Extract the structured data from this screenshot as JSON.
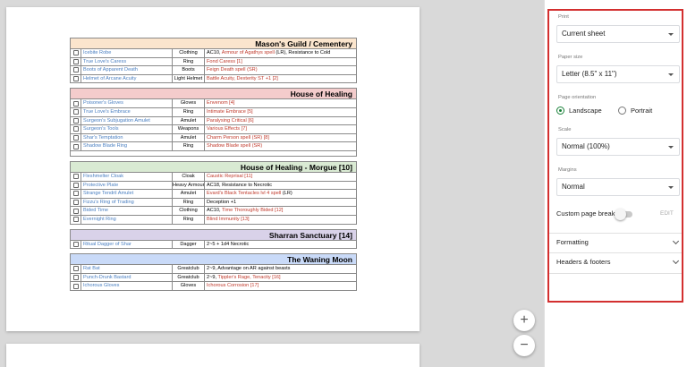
{
  "sheet": {
    "sections": [
      {
        "title": "Mason's Guild / Cementery",
        "color": "#fbe5cd",
        "rows": [
          {
            "name": "Icebite Robe",
            "type": "Clothing",
            "desc": [
              {
                "t": "AC10, ",
                "c": "black"
              },
              {
                "t": "Armour of Agathys spell",
                "c": "red"
              },
              {
                "t": " (LR), Resistance to Cold",
                "c": "black"
              }
            ]
          },
          {
            "name": "True Love's Caress",
            "type": "Ring",
            "desc": [
              {
                "t": "Fond Caress [1]",
                "c": "red"
              }
            ]
          },
          {
            "name": "Boots of Apparent Death",
            "type": "Boots",
            "desc": [
              {
                "t": "Feign Death spell (SR)",
                "c": "red"
              }
            ]
          },
          {
            "name": "Helmet of Arcane Acuity",
            "type": "Light Helmet",
            "desc": [
              {
                "t": "Battle Acuity, Dexterity ST +1 [2]",
                "c": "red"
              }
            ]
          }
        ]
      },
      {
        "title": "House of Healing",
        "color": "#f4cccc",
        "rows": [
          {
            "name": "Poisoner's Gloves",
            "type": "Gloves",
            "desc": [
              {
                "t": "Envenom [4]",
                "c": "red"
              }
            ]
          },
          {
            "name": "True Love's Embrace",
            "type": "Ring",
            "desc": [
              {
                "t": "Intimate Embrace [5]",
                "c": "red"
              }
            ]
          },
          {
            "name": "Surgeon's Subjugation Amulet",
            "type": "Amulet",
            "desc": [
              {
                "t": "Paralysing Critical [6]",
                "c": "red"
              }
            ]
          },
          {
            "name": "Surgeon's Tools",
            "type": "Weapons",
            "desc": [
              {
                "t": "Various Effects [7]",
                "c": "red"
              }
            ]
          },
          {
            "name": "Shar's Temptation",
            "type": "Amulet",
            "desc": [
              {
                "t": "Charm Person spell (SR) [8]",
                "c": "red"
              }
            ]
          },
          {
            "name": "Shadow Blade Ring",
            "type": "Ring",
            "desc": [
              {
                "t": "Shadow Blade spell (SR)",
                "c": "red"
              }
            ]
          }
        ],
        "spacer": true
      },
      {
        "title": "House of Healing - Morgue [10]",
        "color": "#d9ead3",
        "rows": [
          {
            "name": "Fleshmelter Cloak",
            "type": "Cloak",
            "desc": [
              {
                "t": "Caustic Reprisal [11]",
                "c": "red"
              }
            ]
          },
          {
            "name": "Protective Plate",
            "type": "Heavy Armour",
            "desc": [
              {
                "t": "AC18, Resistance to Necrotic",
                "c": "black"
              }
            ]
          },
          {
            "name": "Strange Tendril Amulet",
            "type": "Amulet",
            "desc": [
              {
                "t": "Evard's Black Tentacles lvl 4 spell",
                "c": "red"
              },
              {
                "t": " (LR)",
                "c": "black"
              }
            ]
          },
          {
            "name": "Fizzu's Ring of Trading",
            "type": "Ring",
            "desc": [
              {
                "t": "Deception +1",
                "c": "black"
              }
            ]
          },
          {
            "name": "Bided Time",
            "type": "Clothing",
            "desc": [
              {
                "t": "AC10, ",
                "c": "black"
              },
              {
                "t": "Time Thoroughly Bided [12]",
                "c": "red"
              }
            ]
          },
          {
            "name": "Evernight Ring",
            "type": "Ring",
            "desc": [
              {
                "t": "Blind Immunity [13]",
                "c": "red"
              }
            ]
          }
        ]
      },
      {
        "title": "Sharran Sanctuary [14]",
        "color": "#d9d2e9",
        "rows": [
          {
            "name": "Ritual Dagger of Shar",
            "type": "Dagger",
            "desc": [
              {
                "t": "2~5 + 1d4 Necrotic",
                "c": "black"
              }
            ]
          }
        ]
      },
      {
        "title": "The Waning Moon",
        "color": "#c9daf8",
        "rows": [
          {
            "name": "Rat Bat",
            "type": "Greatclub",
            "desc": [
              {
                "t": "2~9, Advantage on AR against beasts",
                "c": "black"
              }
            ]
          },
          {
            "name": "Punch-Drunk Bastard",
            "type": "Greatclub",
            "desc": [
              {
                "t": "2~9, ",
                "c": "black"
              },
              {
                "t": "Tippler's Rage, Tenacity [16]",
                "c": "red"
              }
            ]
          },
          {
            "name": "Ichorous Gloves",
            "type": "Gloves",
            "desc": [
              {
                "t": "Ichorous Corrosion [17]",
                "c": "red"
              }
            ]
          }
        ]
      }
    ]
  },
  "zoom": {
    "in_label": "+",
    "out_label": "−"
  },
  "settings": {
    "print_label": "Print",
    "print_value": "Current sheet",
    "paper_label": "Paper size",
    "paper_value": "Letter (8.5\" x 11\")",
    "orientation_label": "Page orientation",
    "landscape_label": "Landscape",
    "portrait_label": "Portrait",
    "orientation_selected": "Landscape",
    "scale_label": "Scale",
    "scale_value": "Normal (100%)",
    "margins_label": "Margins",
    "margins_value": "Normal",
    "breaks_label": "Custom page breaks",
    "breaks_edit": "EDIT",
    "formatting_label": "Formatting",
    "headers_label": "Headers & footers"
  },
  "colors": {
    "accent_green": "#188038",
    "frame_red": "#d32f2f",
    "link_blue": "#4a7fc1",
    "desc_red": "#c0392b"
  }
}
